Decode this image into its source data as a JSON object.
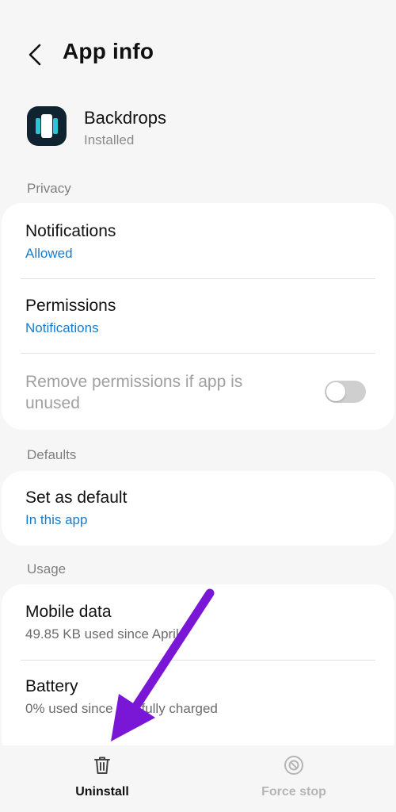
{
  "header": {
    "title": "App info"
  },
  "app": {
    "name": "Backdrops",
    "status": "Installed"
  },
  "privacy": {
    "label": "Privacy",
    "notifications": {
      "title": "Notifications",
      "value": "Allowed"
    },
    "permissions": {
      "title": "Permissions",
      "value": "Notifications"
    },
    "remove_permissions": {
      "line1": "Remove permissions if app is",
      "line2": "unused",
      "enabled": false
    }
  },
  "defaults": {
    "label": "Defaults",
    "set_default": {
      "title": "Set as default",
      "value": "In this app"
    }
  },
  "usage": {
    "label": "Usage",
    "mobile_data": {
      "title": "Mobile data",
      "value": "49.85 KB used since April"
    },
    "battery": {
      "title": "Battery",
      "value": "0% used since last fully charged"
    }
  },
  "bottom_bar": {
    "uninstall_label": "Uninstall",
    "force_stop_label": "Force stop"
  },
  "colors": {
    "accent_blue": "#1a7cc9",
    "annotation_arrow": "#7a16d6",
    "app_icon_bg": "#0f2430",
    "app_icon_accent": "#2ec4d6"
  },
  "icons": {
    "back": "back-arrow-icon",
    "trash": "trash-icon",
    "stop": "stop-icon"
  }
}
